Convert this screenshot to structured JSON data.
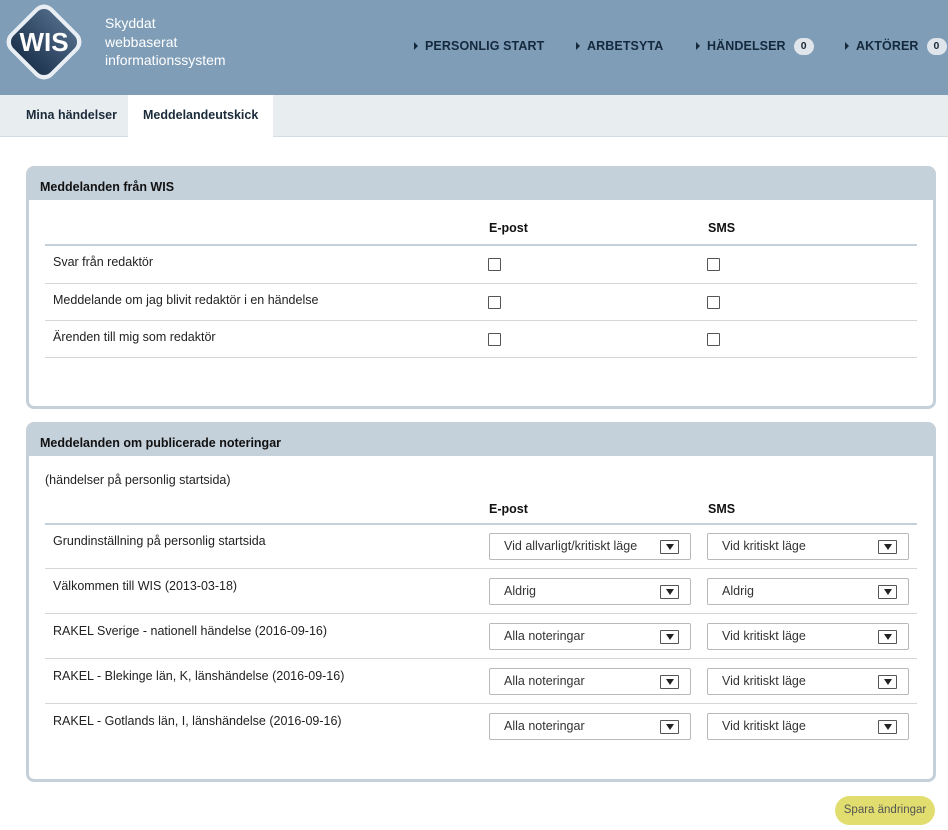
{
  "brand": {
    "logo_text": "WIS",
    "line1": "Skyddat",
    "line2": "webbaserat",
    "line3": "informationssystem"
  },
  "nav": {
    "items": [
      {
        "label": "PERSONLIG START"
      },
      {
        "label": "ARBETSYTA"
      },
      {
        "label": "HÄNDELSER",
        "count": "0"
      },
      {
        "label": "AKTÖRER",
        "count": "0"
      }
    ]
  },
  "tabs": [
    {
      "label": "Mina händelser"
    },
    {
      "label": "Meddelandeutskick",
      "active": true
    }
  ],
  "panel1": {
    "title": "Meddelanden från WIS",
    "col_email": "E-post",
    "col_sms": "SMS",
    "rows": [
      {
        "label": "Svar från redaktör",
        "email": false,
        "sms": false
      },
      {
        "label": "Meddelande om jag blivit redaktör i en händelse",
        "email": false,
        "sms": false
      },
      {
        "label": "Ärenden till mig som redaktör",
        "email": false,
        "sms": false
      }
    ]
  },
  "panel2": {
    "title": "Meddelanden om publicerade noteringar",
    "note": "(händelser på personlig startsida)",
    "col_email": "E-post",
    "col_sms": "SMS",
    "rows": [
      {
        "label": "Grundinställning på personlig startsida",
        "email": "Vid allvarligt/kritiskt läge",
        "sms": "Vid kritiskt läge"
      },
      {
        "label": "Välkommen till WIS (2013-03-18)",
        "email": "Aldrig",
        "sms": "Aldrig"
      },
      {
        "label": "RAKEL Sverige - nationell händelse (2016-09-16)",
        "email": "Alla noteringar",
        "sms": "Vid kritiskt läge"
      },
      {
        "label": "RAKEL - Blekinge län, K, länshändelse (2016-09-16)",
        "email": "Alla noteringar",
        "sms": "Vid kritiskt läge"
      },
      {
        "label": "RAKEL - Gotlands län, I, länshändelse (2016-09-16)",
        "email": "Alla noteringar",
        "sms": "Vid kritiskt läge"
      }
    ]
  },
  "save_button": "Spara ändringar",
  "colors": {
    "header_bg": "#7f9db7",
    "panel_border": "#c4d0da",
    "save_button_bg": "#e1de6f"
  }
}
